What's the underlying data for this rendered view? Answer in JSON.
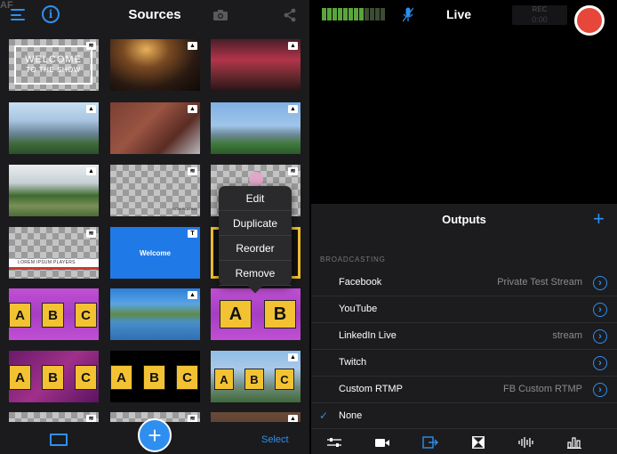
{
  "sources": {
    "title": "Sources",
    "af_label": "AF",
    "tiles": {
      "welcome": {
        "line1": "WELCOME",
        "line2": "TO THE SHOW"
      },
      "lower_third_text": "LOREM IPSUM PLAYERS",
      "welcome_blue": "Welcome",
      "abc": [
        "A",
        "B",
        "C"
      ],
      "ab_big": [
        "A",
        "B"
      ],
      "nowplaying_tag": "NOW PLAYING"
    },
    "menu": [
      "Edit",
      "Duplicate",
      "Reorder",
      "Remove"
    ],
    "select_label": "Select",
    "add_label": "+"
  },
  "live": {
    "title": "Live",
    "rec_label": "REC",
    "rec_time": "0:00",
    "audio_levels": 0.62
  },
  "outputs": {
    "title": "Outputs",
    "add_label": "+",
    "section": "BROADCASTING",
    "rows": [
      {
        "name": "Facebook",
        "value": "Private Test Stream",
        "arrow": true
      },
      {
        "name": "YouTube",
        "value": "",
        "arrow": true
      },
      {
        "name": "LinkedIn Live",
        "value": "stream",
        "arrow": true
      },
      {
        "name": "Twitch",
        "value": "",
        "arrow": true
      },
      {
        "name": "Custom RTMP",
        "value": "FB Custom RTMP",
        "arrow": true
      },
      {
        "name": "None",
        "value": "",
        "arrow": false,
        "checked": true
      }
    ]
  },
  "colors": {
    "accent": "#2f8ff0",
    "record": "#e7463a",
    "tile_yellow": "#f3c233",
    "tile_magenta": "#c14fd4"
  },
  "icons": {
    "left_header": [
      "menu-icon",
      "info-icon",
      "camera-icon",
      "share-icon"
    ],
    "left_footer": [
      "grid-view-icon",
      "slides-view-icon",
      "add-icon"
    ],
    "right_tabs": [
      "mixer-sliders-icon",
      "video-camera-icon",
      "outputs-icon",
      "transitions-icon",
      "audio-waveform-icon",
      "stats-bars-icon"
    ]
  }
}
